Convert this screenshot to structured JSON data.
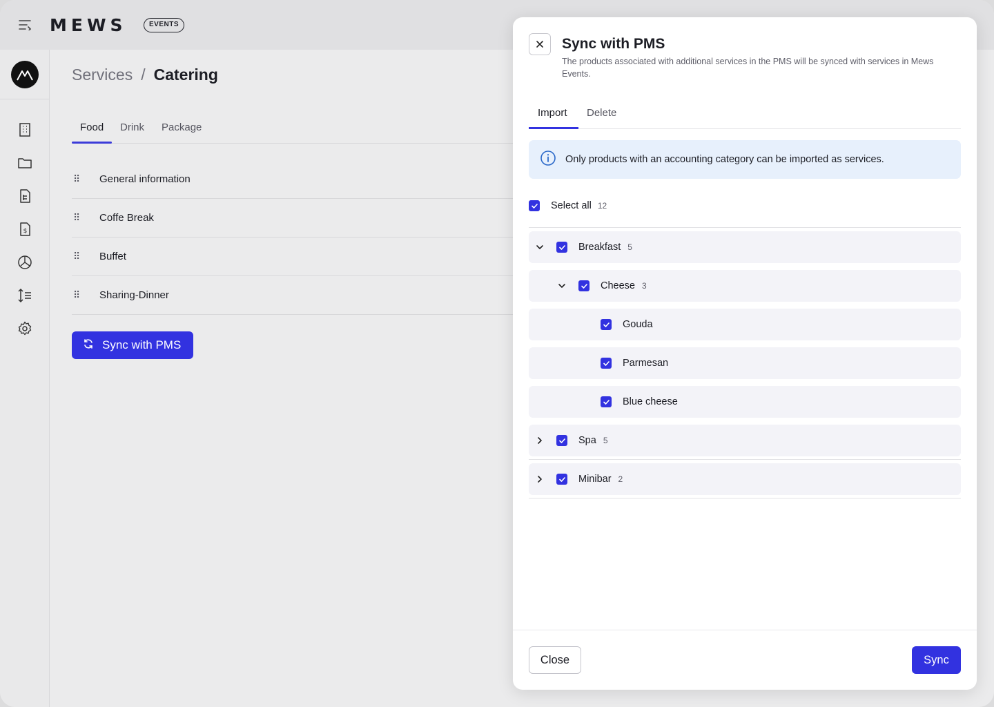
{
  "header": {
    "logo": "MEWS",
    "badge": "EVENTS"
  },
  "breadcrumb": {
    "parent": "Services",
    "separator": "/",
    "current": "Catering"
  },
  "tabs": [
    {
      "label": "Food"
    },
    {
      "label": "Drink"
    },
    {
      "label": "Package"
    }
  ],
  "services": [
    {
      "label": "General information"
    },
    {
      "label": "Coffe Break"
    },
    {
      "label": "Buffet"
    },
    {
      "label": "Sharing-Dinner"
    }
  ],
  "sync_button": "Sync with PMS",
  "panel": {
    "title": "Sync with PMS",
    "description": "The products associated with additional services in the PMS will be synced with services in Mews Events.",
    "tabs": [
      {
        "label": "Import"
      },
      {
        "label": "Delete"
      }
    ],
    "info": "Only products with an accounting category can be imported as services.",
    "select_all": {
      "label": "Select all",
      "count": "12"
    },
    "tree": [
      {
        "label": "Breakfast",
        "count": "5",
        "expanded": true
      },
      {
        "label": "Cheese",
        "count": "3",
        "expanded": true
      },
      {
        "label": "Gouda",
        "count": ""
      },
      {
        "label": "Parmesan",
        "count": ""
      },
      {
        "label": "Blue cheese",
        "count": ""
      },
      {
        "label": "Spa",
        "count": "5",
        "expanded": false
      },
      {
        "label": "Minibar",
        "count": "2",
        "expanded": false
      }
    ],
    "close_label": "Close",
    "sync_label": "Sync"
  },
  "colors": {
    "accent": "#3232e0",
    "info_bg": "#e7f0fc",
    "row_bg": "#f3f3f8"
  }
}
